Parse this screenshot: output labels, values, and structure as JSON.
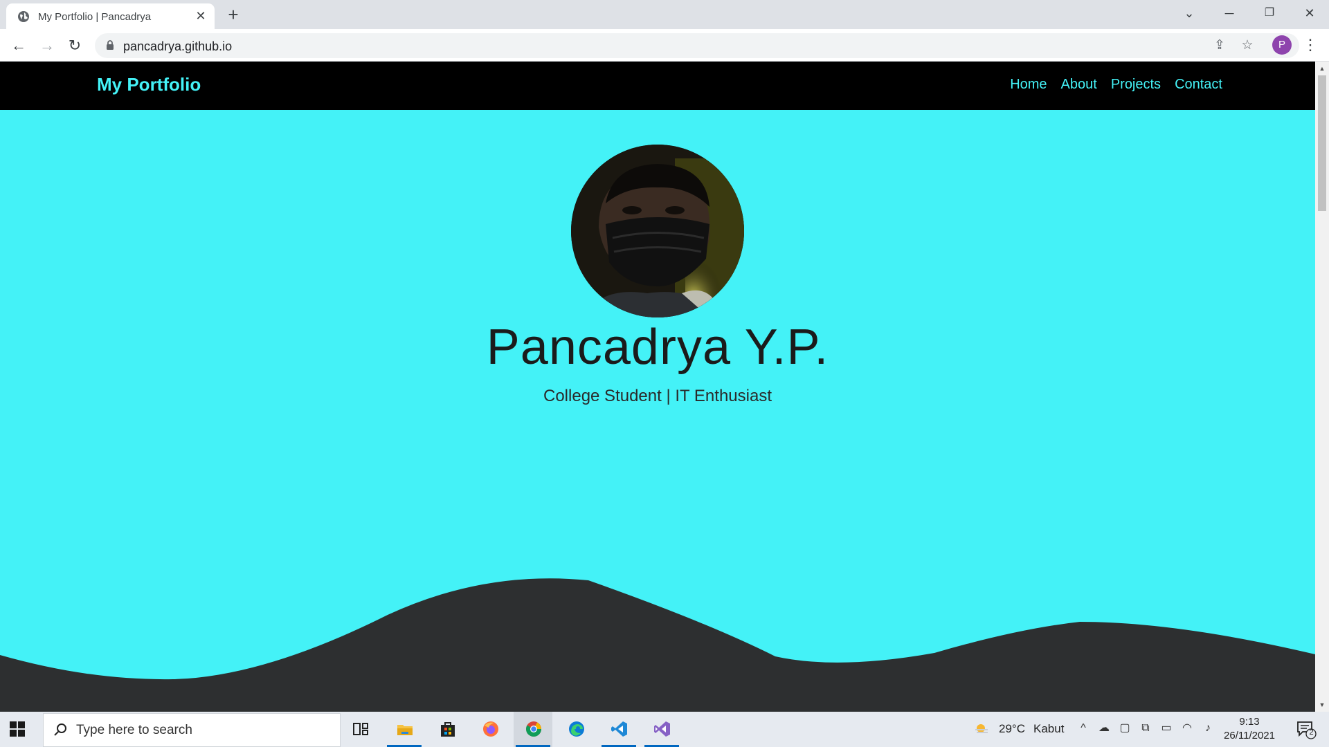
{
  "browser": {
    "tab_title": "My Portfolio | Pancadrya",
    "url": "pancadrya.github.io",
    "profile_initial": "P"
  },
  "site": {
    "brand": "My Portfolio",
    "nav": [
      "Home",
      "About",
      "Projects",
      "Contact"
    ],
    "hero": {
      "name": "Pancadrya Y.P.",
      "tagline": "College Student | IT Enthusiast"
    },
    "colors": {
      "accent": "#44f2f7",
      "nav_bg": "#000000",
      "wave": "#2d2f30"
    }
  },
  "taskbar": {
    "search_placeholder": "Type here to search",
    "weather_temp": "29°C",
    "weather_desc": "Kabut",
    "time": "9:13",
    "date": "26/11/2021",
    "notification_count": "2"
  }
}
